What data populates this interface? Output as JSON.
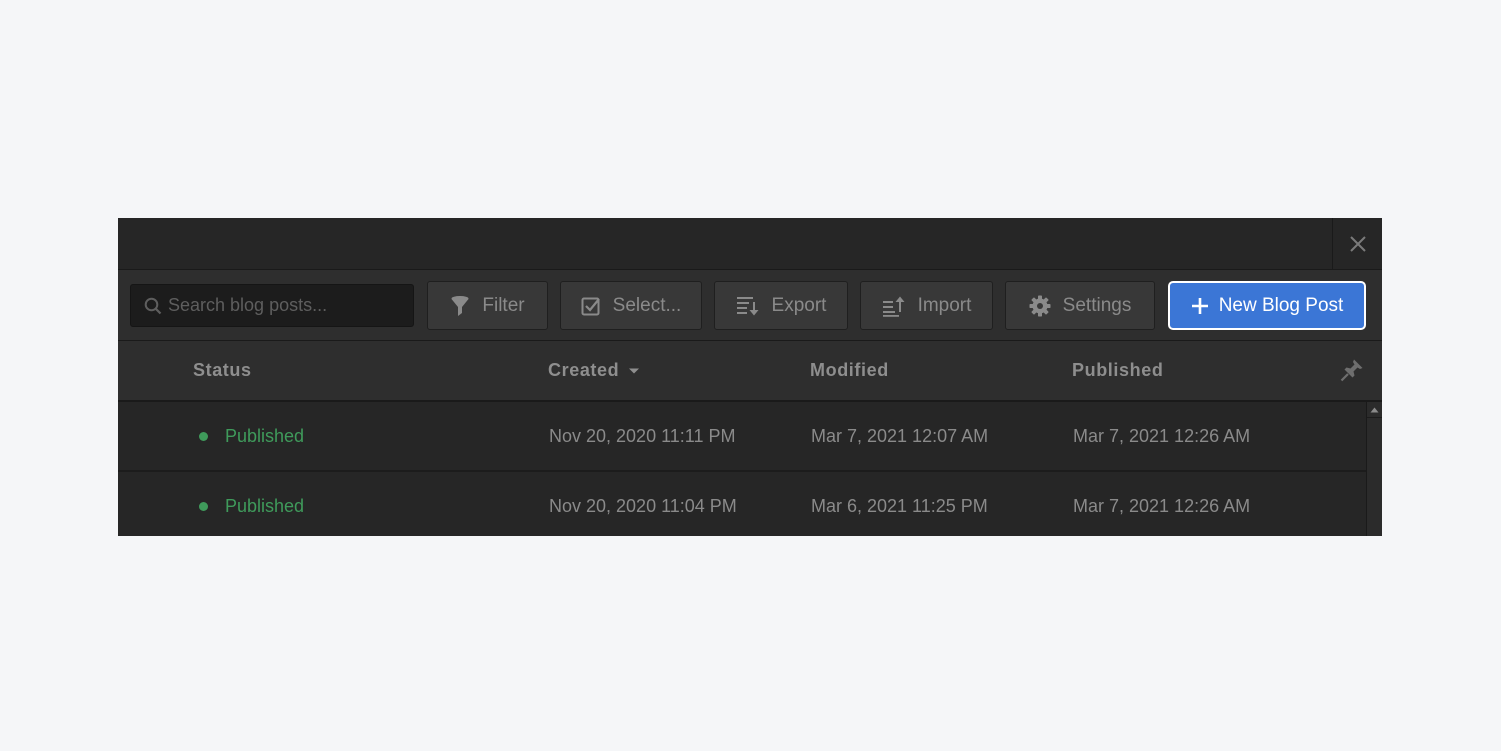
{
  "toolbar": {
    "search": {
      "placeholder": "Search blog posts...",
      "value": "",
      "icon": "search-icon"
    },
    "buttons": [
      {
        "label": "Filter",
        "icon": "filter-icon"
      },
      {
        "label": "Select...",
        "icon": "checkbox-icon"
      },
      {
        "label": "Export",
        "icon": "export-icon"
      },
      {
        "label": "Import",
        "icon": "import-icon"
      },
      {
        "label": "Settings",
        "icon": "gear-icon"
      }
    ],
    "primary": {
      "label": "New Blog Post",
      "icon": "plus-icon",
      "color": "#3b76d6"
    }
  },
  "table": {
    "columns": [
      {
        "label": "Status"
      },
      {
        "label": "Created",
        "sort": "descending"
      },
      {
        "label": "Modified"
      },
      {
        "label": "Published"
      }
    ],
    "rows": [
      {
        "status": "Published",
        "created": "Nov 20, 2020 11:11 PM",
        "modified": "Mar 7, 2021 12:07 AM",
        "published": "Mar 7, 2021 12:26 AM"
      },
      {
        "status": "Published",
        "created": "Nov 20, 2020 11:04 PM",
        "modified": "Mar 6, 2021 11:25 PM",
        "published": "Mar 7, 2021 12:26 AM"
      }
    ]
  },
  "colors": {
    "status_published": "#3f9a5b",
    "primary": "#3b76d6",
    "panel_bg": "#262626"
  }
}
